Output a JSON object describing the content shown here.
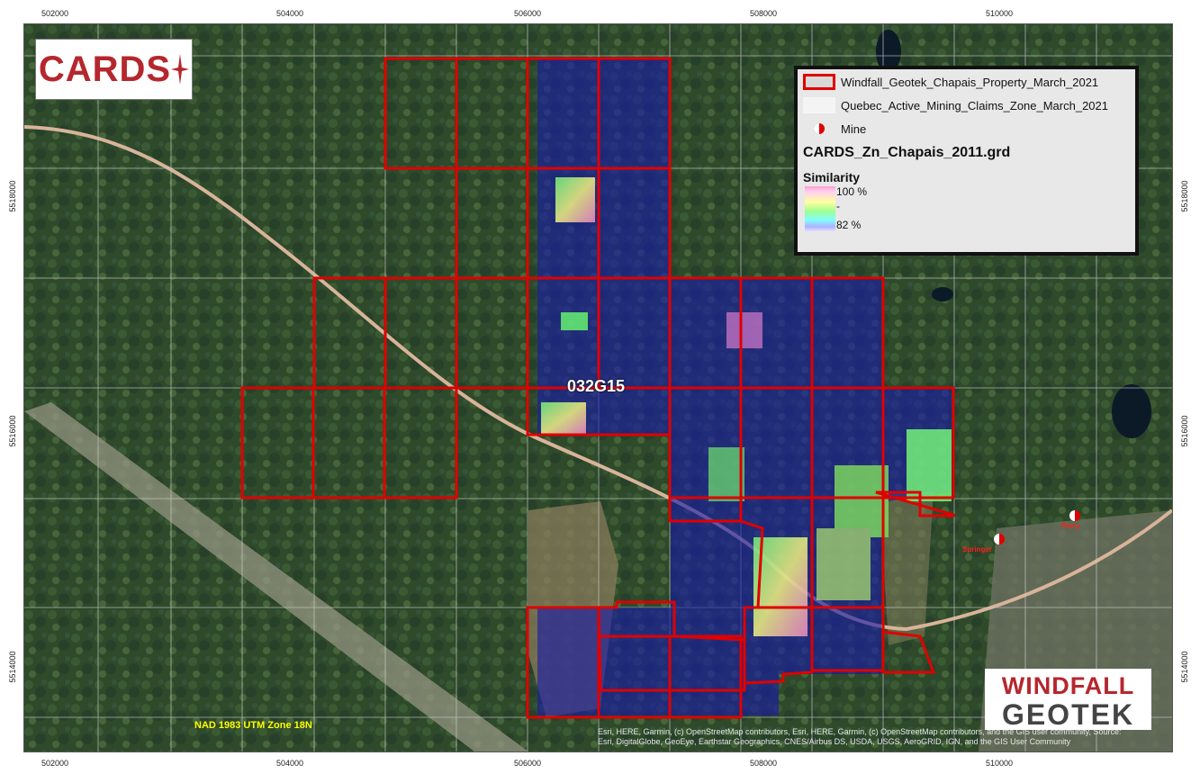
{
  "frame": {
    "top_ticks": [
      "502000",
      "504000",
      "506000",
      "508000",
      "510000"
    ],
    "bottom_ticks": [
      "502000",
      "504000",
      "506000",
      "508000",
      "510000"
    ],
    "left_ticks": [
      "5518000",
      "5516000",
      "5514000"
    ],
    "right_ticks": [
      "5518000",
      "5516000",
      "5514000"
    ]
  },
  "legend": {
    "property_layer": "Windfall_Geotek_Chapais_Property_March_2021",
    "claims_layer": "Quebec_Active_Mining_Claims_Zone_March_2021",
    "mine_label": "Mine",
    "grid_title": "CARDS_Zn_Chapais_2011.grd",
    "similarity_title": "Similarity",
    "ramp_max": "100 %",
    "ramp_mid": "-",
    "ramp_min": "82 %"
  },
  "logos": {
    "cards": "CARDS",
    "windfall_line1": "WINDFALL",
    "windfall_line2": "GEOTEK"
  },
  "map": {
    "sheet_label": "032G15",
    "datum": "NAD 1983 UTM Zone 18N",
    "attribution": "Esri, HERE, Garmin, (c) OpenStreetMap contributors, Esri, HERE, Garmin, (c) OpenStreetMap contributors, and the GIS user community, Source: Esri, DigitalGlobe, GeoEye, Earthstar Geographics, CNES/Airbus DS, USDA, USGS, AeroGRID, IGN, and the GIS User Community",
    "mines": [
      {
        "name": "Springer"
      },
      {
        "name": "Perry"
      }
    ]
  },
  "colors": {
    "property_outline": "#e00000",
    "claim_outline": "#cfcfcf",
    "similarity_low": "#1a1aa8",
    "mine_symbol": "#e00000"
  }
}
